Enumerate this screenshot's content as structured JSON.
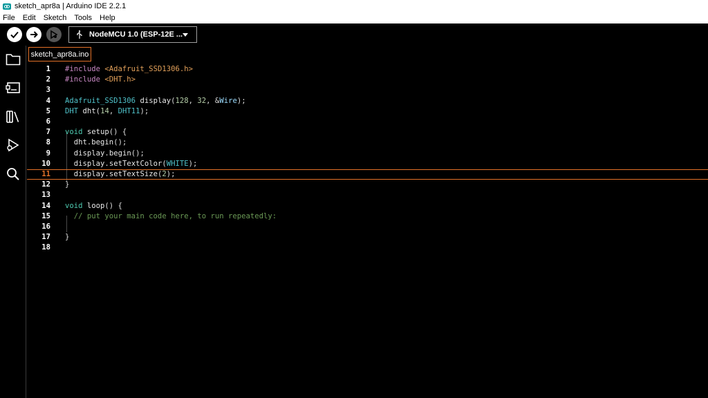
{
  "window": {
    "title": "sketch_apr8a | Arduino IDE 2.2.1"
  },
  "menu": [
    "File",
    "Edit",
    "Sketch",
    "Tools",
    "Help"
  ],
  "toolbar": {
    "verify_icon": "checkmark-icon",
    "upload_icon": "arrow-right-icon",
    "debug_icon": "debug-icon",
    "board_icon": "usb-icon",
    "board_label": "NodeMCU 1.0 (ESP-12E ..."
  },
  "activity": [
    "folder-icon",
    "board-manager-icon",
    "library-icon",
    "debug-icon",
    "search-icon"
  ],
  "tab": {
    "label": "sketch_apr8a.ino"
  },
  "editor": {
    "active_line": 11,
    "lines": [
      {
        "n": "1",
        "text": "#include <Adafruit_SSD1306.h>"
      },
      {
        "n": "2",
        "text": "#include <DHT.h>"
      },
      {
        "n": "3",
        "text": ""
      },
      {
        "n": "4",
        "text": "Adafruit_SSD1306 display(128, 32, &Wire);"
      },
      {
        "n": "5",
        "text": "DHT dht(14, DHT11);"
      },
      {
        "n": "6",
        "text": ""
      },
      {
        "n": "7",
        "text": "void setup() {"
      },
      {
        "n": "8",
        "text": "  dht.begin();"
      },
      {
        "n": "9",
        "text": "  display.begin();"
      },
      {
        "n": "10",
        "text": "  display.setTextColor(WHITE);"
      },
      {
        "n": "11",
        "text": "  display.setTextSize(2);"
      },
      {
        "n": "12",
        "text": "}"
      },
      {
        "n": "13",
        "text": ""
      },
      {
        "n": "14",
        "text": "void loop() {"
      },
      {
        "n": "15",
        "text": "  // put your main code here, to run repeatedly:"
      },
      {
        "n": "16",
        "text": ""
      },
      {
        "n": "17",
        "text": "}"
      },
      {
        "n": "18",
        "text": ""
      }
    ]
  },
  "colors": {
    "accent": "#e47128",
    "background": "#000000",
    "keyword": "#4ec9b0",
    "comment": "#6a9955"
  }
}
